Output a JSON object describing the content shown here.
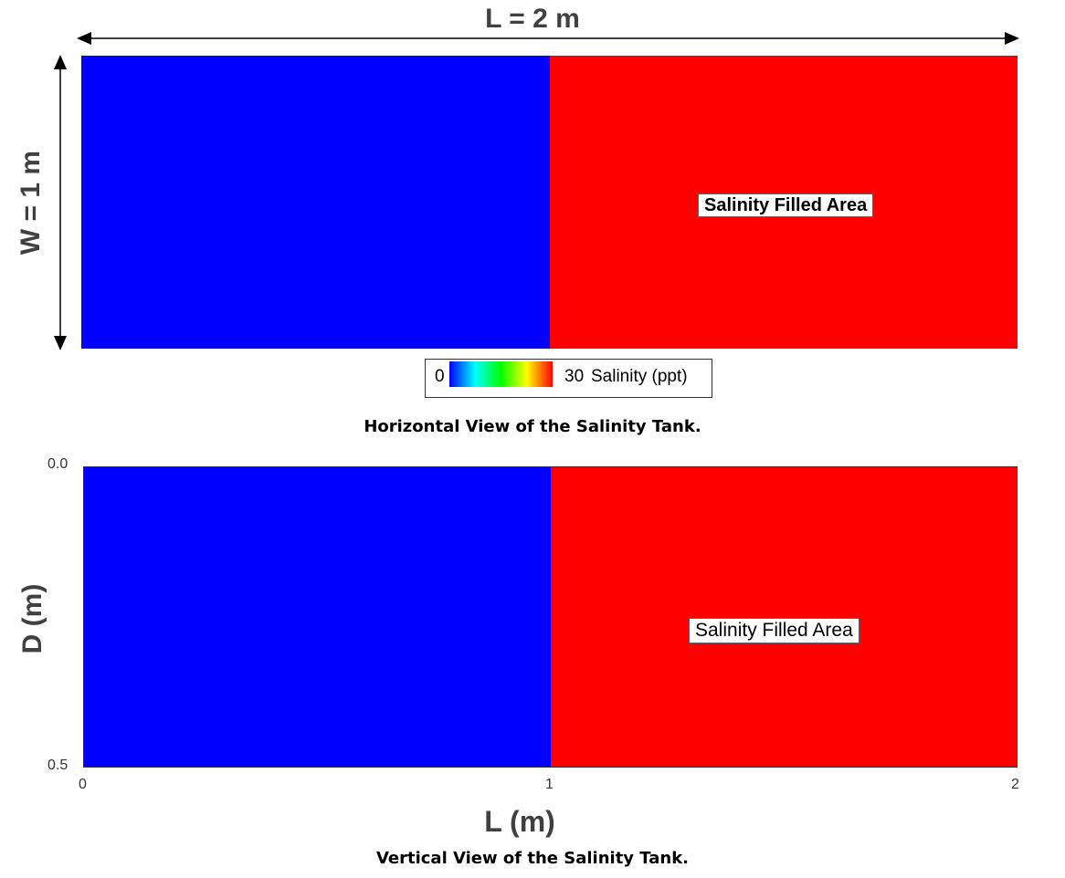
{
  "top_view": {
    "length_label": "L = 2 m",
    "width_label": "W = 1 m",
    "fresh_color": "#0000ff",
    "saline_color": "#ff0000",
    "split_fraction_of_length": 0.5,
    "region_label": "Salinity Filled Area",
    "caption": "Horizontal View of the Salinity Tank."
  },
  "colorbar": {
    "min_label": "0",
    "max_label": "30",
    "title": "Salinity (ppt)",
    "min": 0,
    "max": 30,
    "stops": [
      "#0000ff",
      "#00ffff",
      "#00ff00",
      "#ffff00",
      "#ff0000"
    ]
  },
  "bottom_view": {
    "y_axis_label": "D (m)",
    "x_axis_label": "L (m)",
    "y_ticks": [
      "0.0",
      "0.5"
    ],
    "x_ticks": [
      "0",
      "1",
      "2"
    ],
    "x_range": [
      0,
      2
    ],
    "y_range": [
      0,
      0.5
    ],
    "split_at_L": 1,
    "fresh_color": "#0000ff",
    "saline_color": "#ff0000",
    "region_label": "Salinity Filled Area",
    "caption": "Vertical View of the Salinity Tank."
  }
}
